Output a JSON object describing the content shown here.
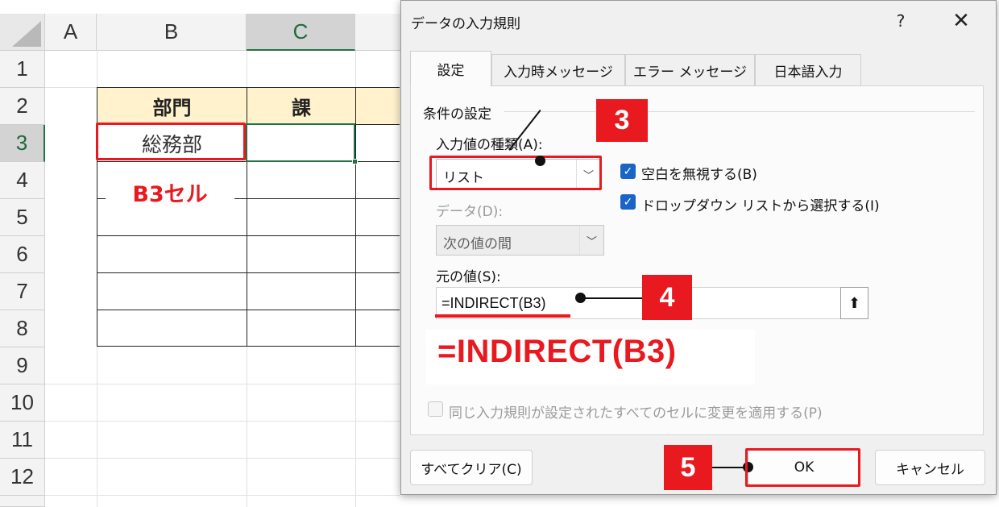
{
  "sheet": {
    "columns": [
      "A",
      "B",
      "C"
    ],
    "rows": [
      "1",
      "2",
      "3",
      "4",
      "5",
      "6",
      "7",
      "8",
      "9",
      "10",
      "11",
      "12"
    ],
    "table_headers": [
      "部門",
      "課"
    ],
    "b3_value": "総務部",
    "b3_annotation": "B3セル"
  },
  "dialog": {
    "title": "データの入力規則",
    "help": "?",
    "close": "✕",
    "tabs": [
      "設定",
      "入力時メッセージ",
      "エラー メッセージ",
      "日本語入力"
    ],
    "group_title": "条件の設定",
    "type_label": "入力値の種類(A):",
    "type_value": "リスト",
    "ignore_blank_label": "空白を無視する(B)",
    "dropdown_label": "ドロップダウン リストから選択する(I)",
    "data_label": "データ(D):",
    "data_value": "次の値の間",
    "source_label": "元の値(S):",
    "source_value": "=INDIRECT(B3)",
    "apply_all_label": "同じ入力規則が設定されたすべてのセルに変更を適用する(P)",
    "clear_button": "すべてクリア(C)",
    "ok_button": "OK",
    "cancel_button": "キャンセル"
  },
  "annotations": {
    "step3": "3",
    "step4": "4",
    "step5": "5",
    "big_formula": "=INDIRECT(B3)",
    "accent_color": "#e8191f"
  },
  "icons": {
    "checkbox_checked": "check-icon",
    "dropdown_arrow": "chevron-down-icon",
    "collapse": "collapse-up-arrow-icon"
  }
}
